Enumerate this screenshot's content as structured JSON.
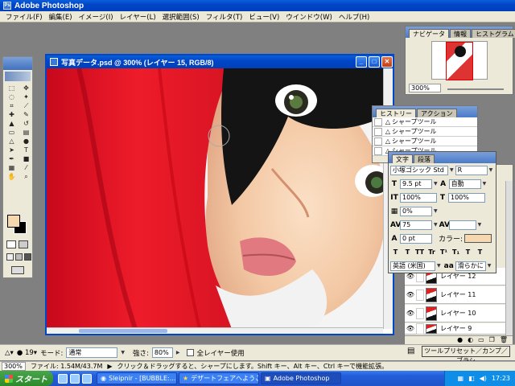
{
  "app": {
    "title": "Adobe Photoshop"
  },
  "menu": [
    "ファイル(F)",
    "編集(E)",
    "イメージ(I)",
    "レイヤー(L)",
    "選択範囲(S)",
    "フィルタ(T)",
    "ビュー(V)",
    "ウインドウ(W)",
    "ヘルプ(H)"
  ],
  "document": {
    "title": "写真データ.psd @ 300% (レイヤー 15, RGB/8)"
  },
  "navigator": {
    "tabs": [
      "ナビゲータ",
      "情報",
      "ヒストグラム"
    ],
    "zoom": "300%"
  },
  "history": {
    "tabs": [
      "ヒストリー",
      "アクション"
    ],
    "items": [
      "シャープツール",
      "シャープツール",
      "シャープツール",
      "シャープツール"
    ]
  },
  "character": {
    "tabs": [
      "文字",
      "段落"
    ],
    "font_family": "小塚ゴシック Std",
    "font_style": "R",
    "font_size": "9.5 pt",
    "leading": "自動",
    "vertical_scale": "100%",
    "horizontal_scale": "100%",
    "tsume": "0%",
    "tracking": "75",
    "baseline_shift": "0 pt",
    "color_label": "カラー:",
    "language": "英語 (米国)",
    "aa_label": "aa",
    "antialias": "滑らかに",
    "style_buttons": [
      "T",
      "T",
      "TT",
      "Tr",
      "T¹",
      "T₁",
      "T",
      "T"
    ]
  },
  "layers": {
    "items": [
      {
        "name": "レイヤー 12"
      },
      {
        "name": "レイヤー 11"
      },
      {
        "name": "レイヤー 10"
      },
      {
        "name": "レイヤー 9"
      }
    ]
  },
  "options": {
    "brush_size": "19",
    "mode_label": "モード:",
    "mode_value": "通常",
    "strength_label": "強さ:",
    "strength_value": "80%",
    "sample_all_label": "全レイヤー使用",
    "tool_preset_label": "ツールプリセット／カンプ／ブラシ"
  },
  "status": {
    "zoom": "300%",
    "file_size": "ファイル: 1.54M/43.7M",
    "hint": "クリック＆ドラッグすると、シャープにします。Shift キー、Alt キー、Ctrl キーで機能拡張。"
  },
  "taskbar": {
    "start": "スタート",
    "tasks": [
      {
        "label": "Sleipnir - [BUBBLE:...",
        "icon": "sleipnir-icon"
      },
      {
        "label": "デザートフェアへようこそ...",
        "icon": "star-icon"
      },
      {
        "label": "Adobe Photoshop",
        "icon": "photoshop-icon"
      }
    ],
    "clock": "17:23"
  },
  "colors": {
    "foreground": "#f5d8b0",
    "background": "#000000",
    "xp_blue": "#0046c8"
  }
}
